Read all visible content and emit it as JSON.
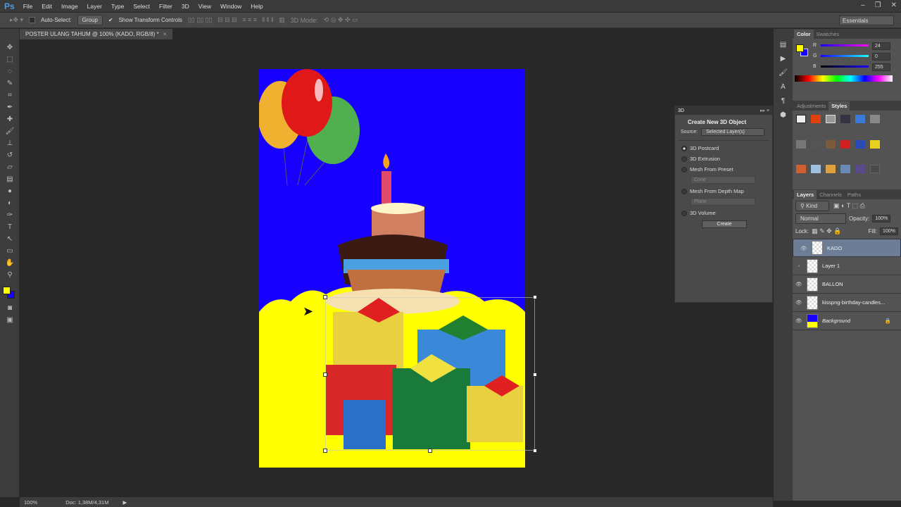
{
  "app": {
    "logo": "Ps",
    "menu": [
      "File",
      "Edit",
      "Image",
      "Layer",
      "Type",
      "Select",
      "Filter",
      "3D",
      "View",
      "Window",
      "Help"
    ],
    "window_buttons": [
      "–",
      "❐",
      "✕"
    ]
  },
  "options": {
    "auto_select_label": "Auto-Select:",
    "auto_select_value": "Group",
    "show_transform_label": "Show Transform Controls",
    "mode_3d_label": "3D Mode:",
    "workspace": "Essentials"
  },
  "document": {
    "tab_title": "POSTER ULANG TAHUM @ 100% (KADO, RGB/8) *",
    "close": "×"
  },
  "status": {
    "zoom": "100%",
    "doc_size": "Doc: 1,38M/4,31M"
  },
  "color_panel": {
    "tabs": [
      "Color",
      "Swatches"
    ],
    "r": "24",
    "g": "0",
    "b": "255",
    "fg": "#ffff00",
    "bg": "#1800ff"
  },
  "adjustments_panel": {
    "tabs": [
      "Adjustments",
      "Styles"
    ]
  },
  "layers_panel": {
    "tabs": [
      "Layers",
      "Channels",
      "Paths"
    ],
    "filter": "Kind",
    "blend_mode": "Normal",
    "opacity_label": "Opacity:",
    "opacity": "100%",
    "lock_label": "Lock:",
    "fill_label": "Fill:",
    "fill": "100%",
    "layers": [
      {
        "name": "KADO",
        "visible": true,
        "selected": true
      },
      {
        "name": "Layer 1",
        "visible": false
      },
      {
        "name": "BALLON",
        "visible": true
      },
      {
        "name": "kisspng-birthday-candles...",
        "visible": true
      },
      {
        "name": "Background",
        "visible": true,
        "locked": true
      }
    ]
  },
  "panel_3d": {
    "tab": "3D",
    "title": "Create New 3D Object",
    "source_label": "Source:",
    "source_value": "Selected Layer(s)",
    "options": [
      "3D Postcard",
      "3D Extrusion",
      "Mesh From Preset",
      "Mesh From Depth Map",
      "3D Volume"
    ],
    "preset_value": "Cone",
    "depth_value": "Plane",
    "create_label": "Create"
  }
}
